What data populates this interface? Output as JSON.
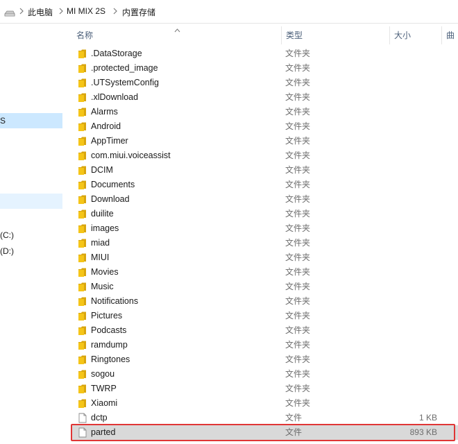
{
  "breadcrumb": [
    "此电脑",
    "MI MIX 2S",
    "内置存储"
  ],
  "nav": {
    "items": [
      {
        "label": "S",
        "state": "selected"
      },
      {
        "label": "",
        "state": "hover"
      },
      {
        "label": "(C:)",
        "state": "normal"
      },
      {
        "label": "(D:)",
        "state": "normal"
      }
    ]
  },
  "columns": {
    "name": "名称",
    "type": "类型",
    "size": "大小",
    "extra": "曲目"
  },
  "files": [
    {
      "name": ".DataStorage",
      "type": "文件夹",
      "size": "",
      "kind": "folder"
    },
    {
      "name": ".protected_image",
      "type": "文件夹",
      "size": "",
      "kind": "folder"
    },
    {
      "name": ".UTSystemConfig",
      "type": "文件夹",
      "size": "",
      "kind": "folder"
    },
    {
      "name": ".xlDownload",
      "type": "文件夹",
      "size": "",
      "kind": "folder"
    },
    {
      "name": "Alarms",
      "type": "文件夹",
      "size": "",
      "kind": "folder"
    },
    {
      "name": "Android",
      "type": "文件夹",
      "size": "",
      "kind": "folder"
    },
    {
      "name": "AppTimer",
      "type": "文件夹",
      "size": "",
      "kind": "folder"
    },
    {
      "name": "com.miui.voiceassist",
      "type": "文件夹",
      "size": "",
      "kind": "folder"
    },
    {
      "name": "DCIM",
      "type": "文件夹",
      "size": "",
      "kind": "folder"
    },
    {
      "name": "Documents",
      "type": "文件夹",
      "size": "",
      "kind": "folder"
    },
    {
      "name": "Download",
      "type": "文件夹",
      "size": "",
      "kind": "folder"
    },
    {
      "name": "duilite",
      "type": "文件夹",
      "size": "",
      "kind": "folder"
    },
    {
      "name": "images",
      "type": "文件夹",
      "size": "",
      "kind": "folder"
    },
    {
      "name": "miad",
      "type": "文件夹",
      "size": "",
      "kind": "folder"
    },
    {
      "name": "MIUI",
      "type": "文件夹",
      "size": "",
      "kind": "folder"
    },
    {
      "name": "Movies",
      "type": "文件夹",
      "size": "",
      "kind": "folder"
    },
    {
      "name": "Music",
      "type": "文件夹",
      "size": "",
      "kind": "folder"
    },
    {
      "name": "Notifications",
      "type": "文件夹",
      "size": "",
      "kind": "folder"
    },
    {
      "name": "Pictures",
      "type": "文件夹",
      "size": "",
      "kind": "folder"
    },
    {
      "name": "Podcasts",
      "type": "文件夹",
      "size": "",
      "kind": "folder"
    },
    {
      "name": "ramdump",
      "type": "文件夹",
      "size": "",
      "kind": "folder"
    },
    {
      "name": "Ringtones",
      "type": "文件夹",
      "size": "",
      "kind": "folder"
    },
    {
      "name": "sogou",
      "type": "文件夹",
      "size": "",
      "kind": "folder"
    },
    {
      "name": "TWRP",
      "type": "文件夹",
      "size": "",
      "kind": "folder"
    },
    {
      "name": "Xiaomi",
      "type": "文件夹",
      "size": "",
      "kind": "folder"
    },
    {
      "name": "dctp",
      "type": "文件",
      "size": "1 KB",
      "kind": "file"
    },
    {
      "name": "parted",
      "type": "文件",
      "size": "893 KB",
      "kind": "file",
      "selected": true
    }
  ],
  "colors": {
    "folder": "#f5c518",
    "folder_dark": "#d9a60e",
    "selection": "#cce8ff",
    "highlight_border": "#e03535"
  }
}
